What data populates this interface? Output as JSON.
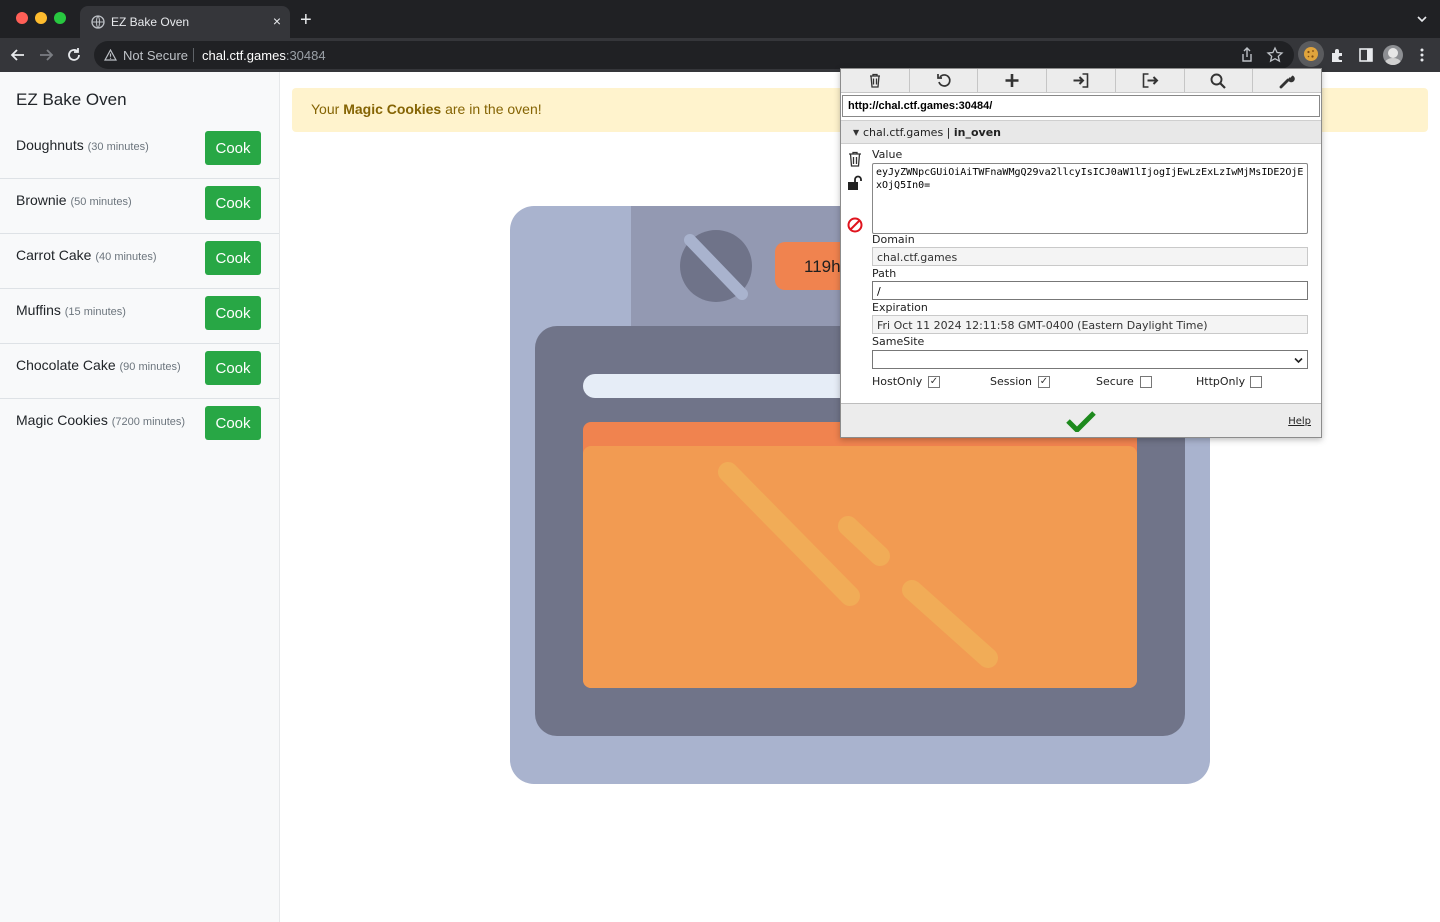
{
  "browser": {
    "tab_title": "EZ Bake Oven",
    "tab_close": "×",
    "new_tab": "+",
    "security_label": "Not Secure",
    "url_host": "chal.ctf.games",
    "url_port": ":30484"
  },
  "sidebar": {
    "brand": "EZ Bake Oven",
    "cook_label": "Cook",
    "items": [
      {
        "name": "Doughnuts",
        "time": "(30 minutes)"
      },
      {
        "name": "Brownie",
        "time": "(50 minutes)"
      },
      {
        "name": "Carrot Cake",
        "time": "(40 minutes)"
      },
      {
        "name": "Muffins",
        "time": "(15 minutes)"
      },
      {
        "name": "Chocolate Cake",
        "time": "(90 minutes)"
      },
      {
        "name": "Magic Cookies",
        "time": "(7200 minutes)"
      }
    ]
  },
  "alert": {
    "prefix": "Your ",
    "highlight": "Magic Cookies",
    "suffix": " are in the oven!"
  },
  "oven": {
    "timer_text": "119h"
  },
  "cookie_editor": {
    "url": "http://chal.ctf.games:30484/",
    "cookie_domain": "chal.ctf.games",
    "cookie_separator": " | ",
    "cookie_name": "in_oven",
    "labels": {
      "value": "Value",
      "domain": "Domain",
      "path": "Path",
      "expiration": "Expiration",
      "samesite": "SameSite",
      "hostonly": "HostOnly",
      "session": "Session",
      "secure": "Secure",
      "httponly": "HttpOnly",
      "help": "Help"
    },
    "value": "eyJyZWNpcGUiOiAiTWFnaWMgQ29va2llcyIsICJ0aW1lIjogIjEwLzExLzIwMjMsIDE2OjExOjQ5In0=",
    "domain": "chal.ctf.games",
    "path": "/",
    "expiration": "Fri Oct 11 2024 12:11:58 GMT-0400 (Eastern Daylight Time)",
    "samesite": "",
    "hostonly_mark": "✓",
    "session_mark": "✓"
  },
  "colors": {
    "cook_button": "#28a745",
    "alert_bg": "#fff3cd",
    "oven_body": "#a9b3ce",
    "oven_door": "#707489",
    "oven_window": "#f29b52"
  }
}
